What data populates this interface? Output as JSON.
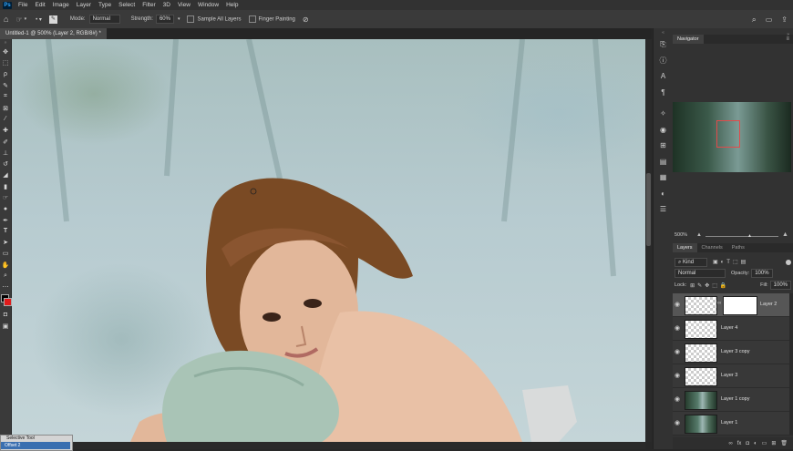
{
  "menu": [
    "File",
    "Edit",
    "Image",
    "Layer",
    "Type",
    "Select",
    "Filter",
    "3D",
    "View",
    "Window",
    "Help"
  ],
  "app_logo": "Ps",
  "options": {
    "mode_label": "Mode:",
    "mode_value": "Normal",
    "strength_label": "Strength:",
    "strength_value": "60%",
    "sample_all_layers": "Sample All Layers",
    "finger_painting": "Finger Painting"
  },
  "document_tab": "Untitled-1 @ 500% (Layer 2, RGB/8#) *",
  "icons": {
    "home": "home-icon",
    "brush_preset": "brush-icon",
    "search": "search-icon",
    "workspace": "workspace-icon",
    "share": "share-icon",
    "collapse": "collapse-icon",
    "panel_menu": "menu-icon"
  },
  "navigator": {
    "tab": "Navigator",
    "zoom": "500%"
  },
  "layers_panel": {
    "tabs": [
      "Layers",
      "Channels",
      "Paths"
    ],
    "kind_label": "Kind",
    "blend_mode": "Normal",
    "opacity_label": "Opacity:",
    "opacity_value": "100%",
    "lock_label": "Lock:",
    "fill_label": "Fill:",
    "fill_value": "100%",
    "layers": [
      {
        "name": "Layer 2",
        "thumb": "checker",
        "selected": true,
        "mask": true
      },
      {
        "name": "Layer 4",
        "thumb": "checker",
        "selected": false,
        "mask": false
      },
      {
        "name": "Layer 3 copy",
        "thumb": "checker",
        "selected": false,
        "mask": false
      },
      {
        "name": "Layer 3",
        "thumb": "checker",
        "selected": false,
        "mask": false
      },
      {
        "name": "Layer 1 copy",
        "thumb": "forest",
        "selected": false,
        "mask": false
      },
      {
        "name": "Layer 1",
        "thumb": "forest",
        "selected": false,
        "mask": false
      }
    ]
  },
  "selective_panel": {
    "title": "Selective Tool",
    "item": "Offset 2"
  },
  "colors": {
    "foreground": "#000000",
    "background": "#e01b1b",
    "accent": "#31a8ff"
  }
}
